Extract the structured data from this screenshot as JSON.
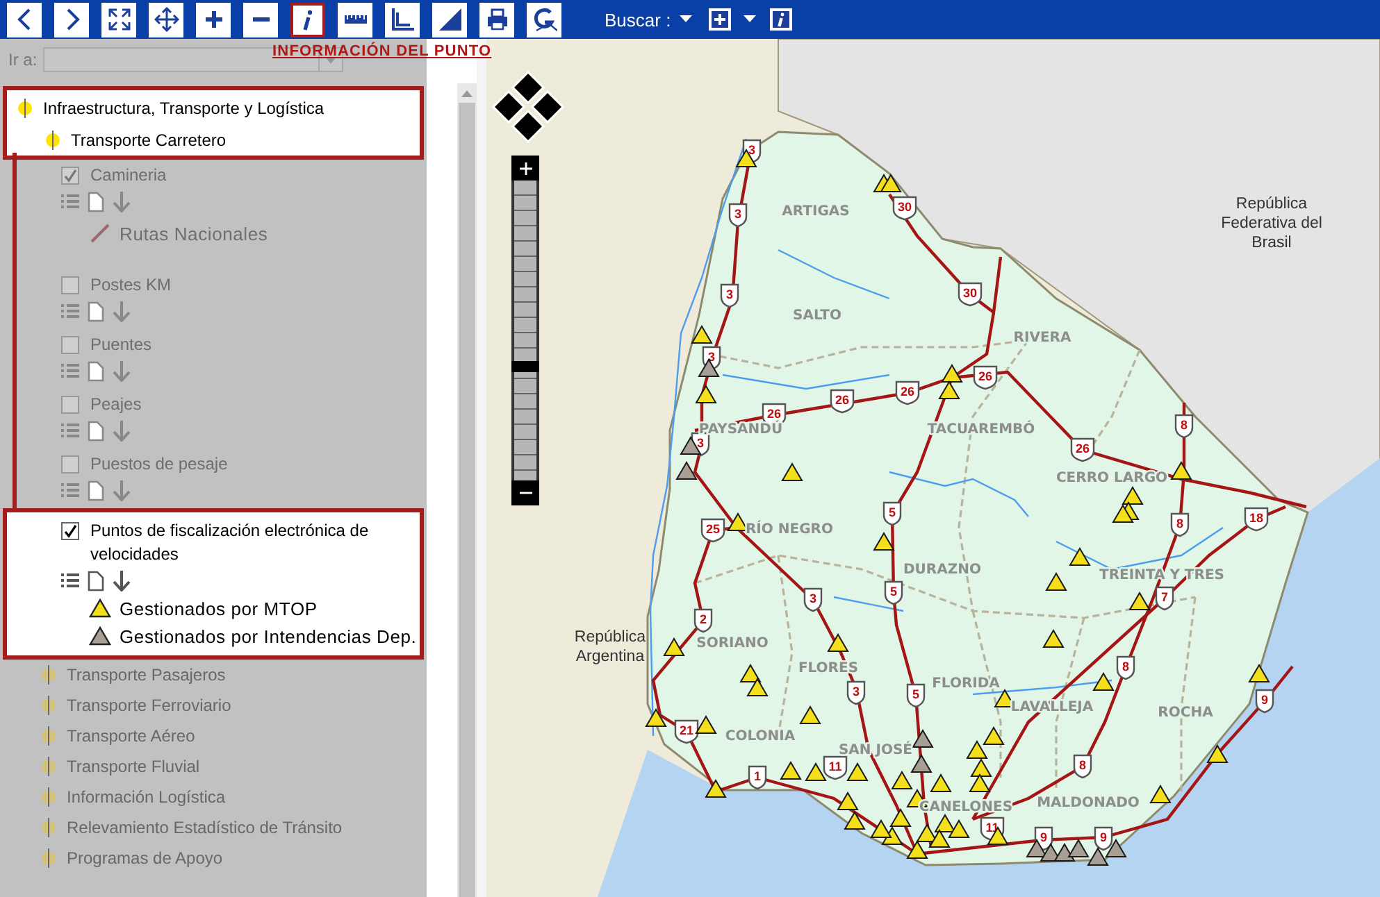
{
  "toolbar": {
    "buttons": [
      {
        "kind": "back",
        "highlighted": false
      },
      {
        "kind": "forward",
        "highlighted": false
      },
      {
        "kind": "full-extent",
        "highlighted": false
      },
      {
        "kind": "pan",
        "highlighted": false
      },
      {
        "kind": "zoom-in",
        "highlighted": false
      },
      {
        "kind": "zoom-out",
        "highlighted": false
      },
      {
        "kind": "info",
        "highlighted": true
      },
      {
        "kind": "ruler",
        "highlighted": false
      },
      {
        "kind": "area",
        "highlighted": false
      },
      {
        "kind": "profile",
        "highlighted": false
      },
      {
        "kind": "print",
        "highlighted": false
      },
      {
        "kind": "geo",
        "highlighted": false
      }
    ],
    "search_label": "Buscar :",
    "extra_buttons": [
      {
        "kind": "add-layer",
        "dropdown": true
      },
      {
        "kind": "info-box",
        "dropdown": false
      }
    ],
    "callout": "INFORMACIÓN DEL PUNTO"
  },
  "sidebar": {
    "goto_label": "Ir a:",
    "tree": [
      {
        "label": "Infraestructura, Transporte y Logística",
        "highlighted": true,
        "children": [
          {
            "label": "Transporte Carretero",
            "highlighted": true,
            "layers": [
              {
                "label": "Camineria",
                "checked": true,
                "highlighted": false,
                "legend": [
                  {
                    "kind": "line",
                    "label": "Rutas Nacionales"
                  }
                ]
              },
              {
                "label": "Postes KM",
                "checked": false,
                "highlighted": false
              },
              {
                "label": "Puentes",
                "checked": false,
                "highlighted": false
              },
              {
                "label": "Peajes",
                "checked": false,
                "highlighted": false
              },
              {
                "label": "Puestos de pesaje",
                "checked": false,
                "highlighted": false
              },
              {
                "label": "Puntos de fiscalización electrónica de velocidades",
                "checked": true,
                "highlighted": true,
                "legend": [
                  {
                    "kind": "mtop",
                    "label": "Gestionados por MTOP"
                  },
                  {
                    "kind": "intendencia",
                    "label": "Gestionados por Intendencias Dep."
                  }
                ]
              }
            ]
          },
          {
            "label": "Transporte Pasajeros",
            "highlighted": false
          },
          {
            "label": "Transporte Ferroviario",
            "highlighted": false
          },
          {
            "label": "Transporte Aéreo",
            "highlighted": false
          },
          {
            "label": "Transporte Fluvial",
            "highlighted": false
          },
          {
            "label": "Información Logística",
            "highlighted": false
          },
          {
            "label": "Relevamiento Estadístico de Tránsito",
            "highlighted": false
          },
          {
            "label": "Programas de Apoyo",
            "highlighted": false
          }
        ]
      }
    ]
  },
  "map": {
    "zoom": {
      "level": 0.38
    },
    "countries": [
      "República Federativa del Brasil",
      "República Argentina"
    ],
    "departments": [
      "ARTIGAS",
      "SALTO",
      "RIVERA",
      "PAYSANDÚ",
      "TACUAREMBÓ",
      "CERRO LARGO",
      "RÍO NEGRO",
      "DURAZNO",
      "TREINTA Y TRES",
      "SORIANO",
      "FLORES",
      "FLORIDA",
      "LAVALLEJA",
      "ROCHA",
      "COLONIA",
      "SAN JOSÉ",
      "CANELONES",
      "MALDONADO"
    ],
    "routes": [
      "3",
      "3",
      "30",
      "30",
      "3",
      "3",
      "26",
      "26",
      "26",
      "26",
      "26",
      "3",
      "8",
      "8",
      "18",
      "25",
      "5",
      "5",
      "3",
      "2",
      "3",
      "5",
      "8",
      "8",
      "7",
      "9",
      "9",
      "9",
      "21",
      "1",
      "11",
      "11"
    ],
    "markers": [
      {
        "kind": "mtop"
      },
      {
        "kind": "mtop"
      },
      {
        "kind": "mtop"
      },
      {
        "kind": "mtop"
      },
      {
        "kind": "mtop"
      },
      {
        "kind": "mtop"
      },
      {
        "kind": "mtop"
      },
      {
        "kind": "mtop"
      },
      {
        "kind": "mtop"
      },
      {
        "kind": "mtop"
      },
      {
        "kind": "mtop"
      },
      {
        "kind": "mtop"
      },
      {
        "kind": "mtop"
      },
      {
        "kind": "mtop"
      },
      {
        "kind": "mtop"
      },
      {
        "kind": "mtop"
      },
      {
        "kind": "mtop"
      },
      {
        "kind": "mtop"
      },
      {
        "kind": "mtop"
      },
      {
        "kind": "mtop"
      },
      {
        "kind": "mtop"
      },
      {
        "kind": "mtop"
      },
      {
        "kind": "mtop"
      },
      {
        "kind": "mtop"
      },
      {
        "kind": "mtop"
      },
      {
        "kind": "mtop"
      },
      {
        "kind": "mtop"
      },
      {
        "kind": "mtop"
      },
      {
        "kind": "mtop"
      },
      {
        "kind": "mtop"
      },
      {
        "kind": "mtop"
      },
      {
        "kind": "mtop"
      },
      {
        "kind": "mtop"
      },
      {
        "kind": "mtop"
      },
      {
        "kind": "mtop"
      },
      {
        "kind": "mtop"
      },
      {
        "kind": "mtop"
      },
      {
        "kind": "mtop"
      },
      {
        "kind": "mtop"
      },
      {
        "kind": "mtop"
      },
      {
        "kind": "mtop"
      },
      {
        "kind": "mtop"
      },
      {
        "kind": "mtop"
      },
      {
        "kind": "mtop"
      },
      {
        "kind": "mtop"
      },
      {
        "kind": "mtop"
      },
      {
        "kind": "mtop"
      },
      {
        "kind": "mtop"
      },
      {
        "kind": "mtop"
      },
      {
        "kind": "mtop"
      },
      {
        "kind": "mtop"
      },
      {
        "kind": "mtop"
      },
      {
        "kind": "intendencia"
      },
      {
        "kind": "intendencia"
      },
      {
        "kind": "intendencia"
      },
      {
        "kind": "intendencia"
      },
      {
        "kind": "intendencia"
      },
      {
        "kind": "intendencia"
      },
      {
        "kind": "intendencia"
      },
      {
        "kind": "intendencia"
      },
      {
        "kind": "intendencia"
      },
      {
        "kind": "intendencia"
      },
      {
        "kind": "intendencia"
      }
    ]
  }
}
